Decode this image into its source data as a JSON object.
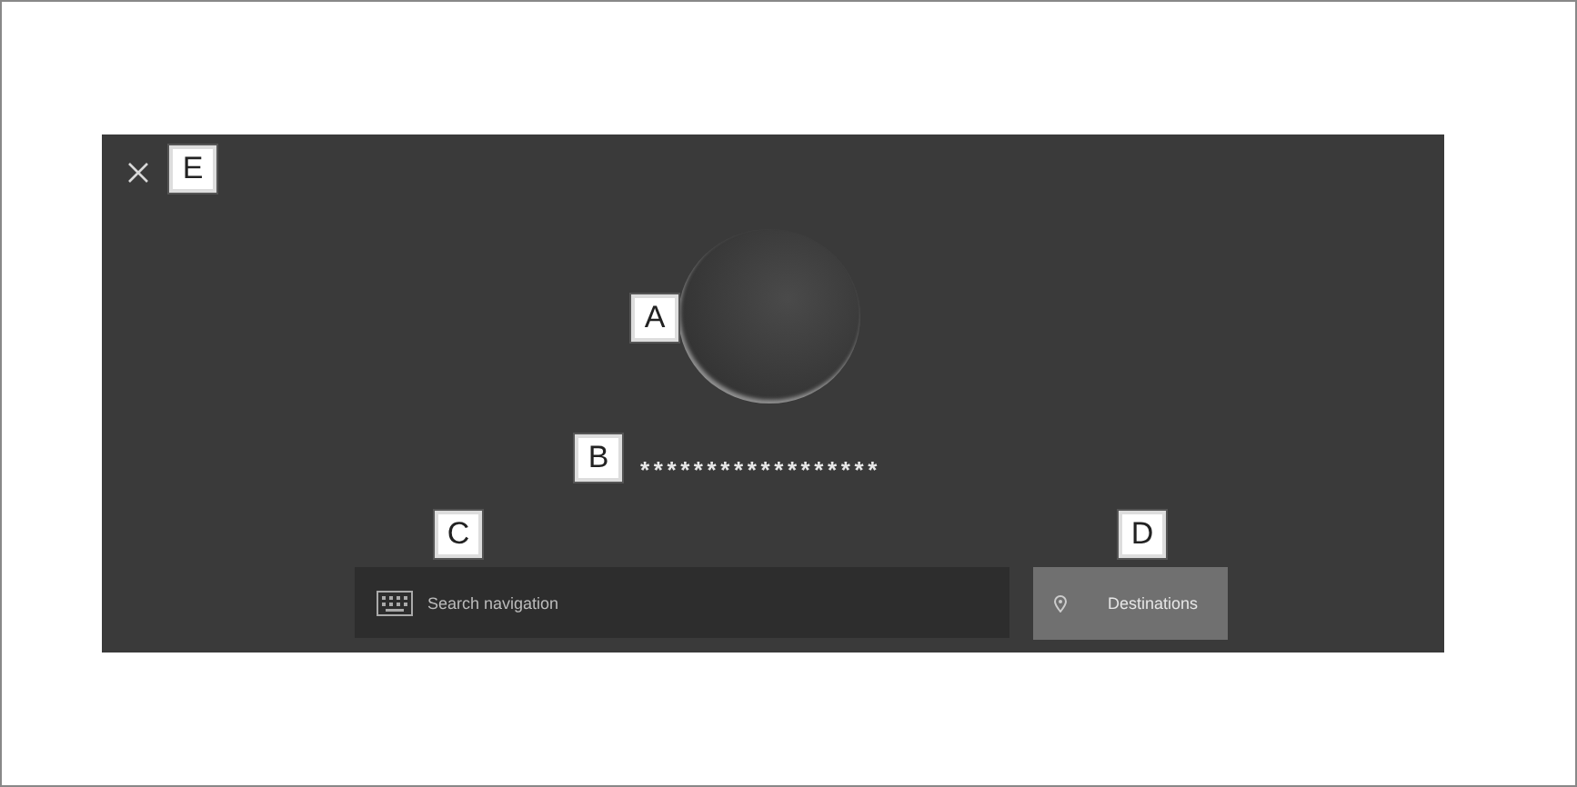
{
  "screen": {
    "masked_text": "******************",
    "search": {
      "placeholder": "Search navigation"
    },
    "destinations_button": {
      "label": "Destinations"
    }
  },
  "callouts": [
    {
      "letter": "E"
    },
    {
      "letter": "A"
    },
    {
      "letter": "B"
    },
    {
      "letter": "C"
    },
    {
      "letter": "D"
    }
  ]
}
